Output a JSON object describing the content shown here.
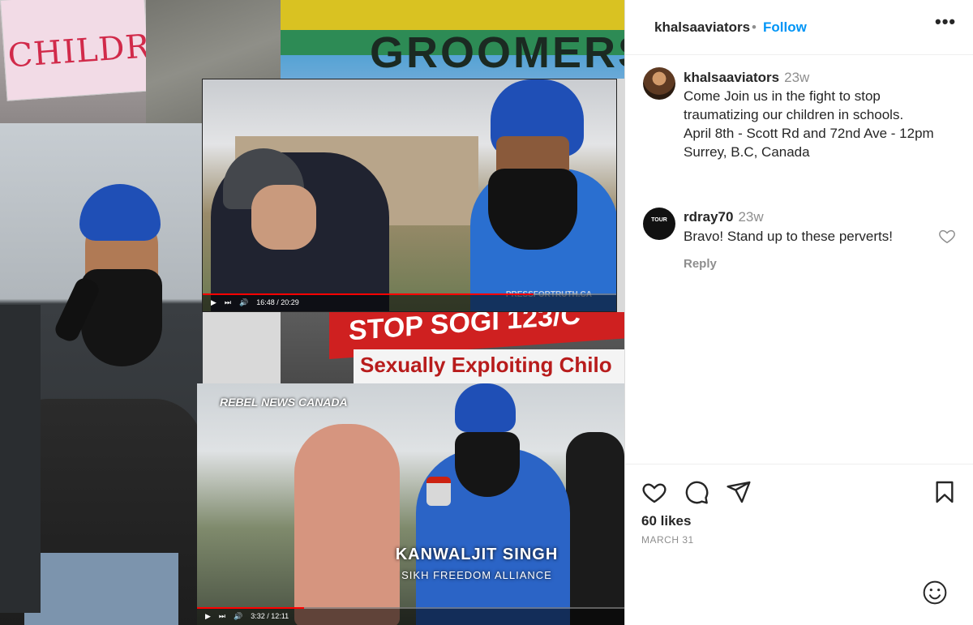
{
  "image": {
    "sign_text": "CHILDREN",
    "banner_text": "GROOMERS",
    "video_top_watermark": "PRESSFORTRUTH.CA",
    "video_top_time": "16:48 / 20:29",
    "sogi_line1": "STOP SOGI 123/C",
    "sogi_line2": "Sexually Exploiting Chilo",
    "rebel_logo": "REBEL NEWS CANADA",
    "lower_third_name": "KANWALJIT SINGH",
    "lower_third_org": "SIKH FREEDOM ALLIANCE",
    "video_bottom_time": "3:32 / 12:11"
  },
  "header": {
    "username": "khalsaaviators",
    "separator": "•",
    "follow_label": "Follow",
    "more_label": "•••"
  },
  "caption": {
    "username": "khalsaaviators",
    "time": "23w",
    "lines": [
      "Come Join us in the fight to stop",
      "traumatizing our children in schools.",
      "April 8th - Scott Rd and 72nd Ave - 12pm",
      "Surrey, B.C, Canada"
    ]
  },
  "comment": {
    "username": "rdray70",
    "time": "23w",
    "text": "Bravo! Stand up to these perverts!",
    "reply_label": "Reply",
    "avatar_text": "TOUR"
  },
  "actions": {
    "likes": "60 likes",
    "date": "MARCH 31"
  }
}
